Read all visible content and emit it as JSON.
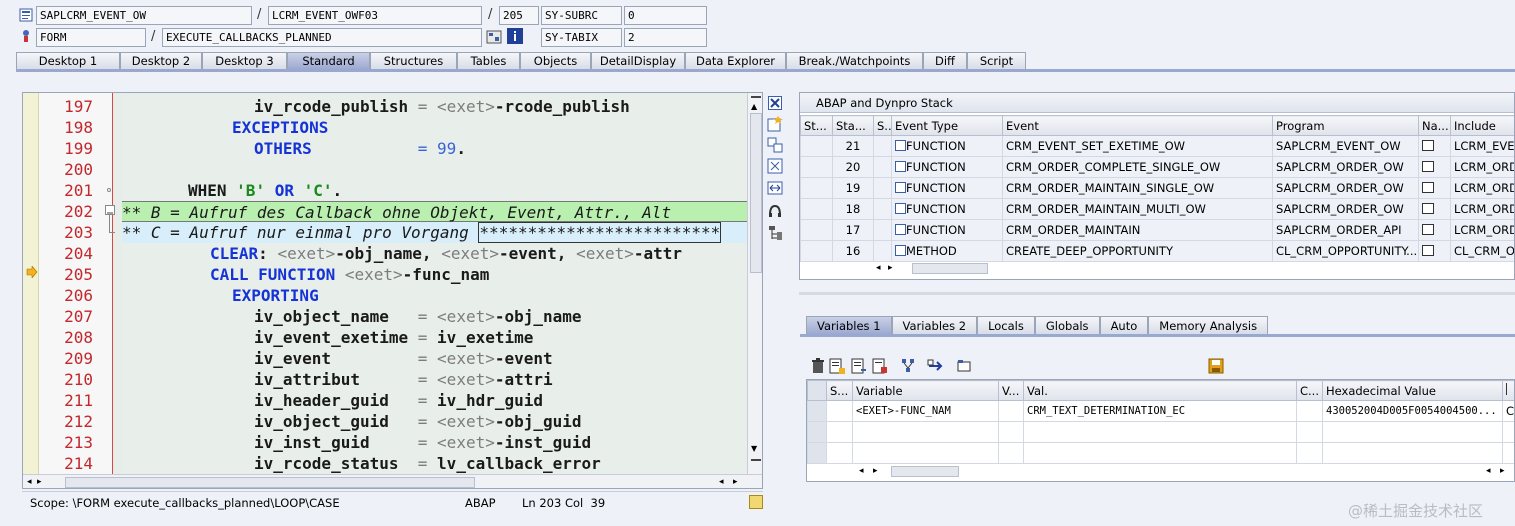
{
  "header": {
    "row1": {
      "program": "SAPLCRM_EVENT_OW",
      "include": "LCRM_EVENT_OWF03",
      "line": "205",
      "sysvar": "SY-SUBRC",
      "sysval": "0"
    },
    "row2": {
      "type": "FORM",
      "name": "EXECUTE_CALLBACKS_PLANNED",
      "sysvar": "SY-TABIX",
      "sysval": "2"
    }
  },
  "tabs": [
    "Desktop 1",
    "Desktop 2",
    "Desktop 3",
    "Standard",
    "Structures",
    "Tables",
    "Objects",
    "DetailDisplay",
    "Data Explorer",
    "Break./Watchpoints",
    "Diff",
    "Script"
  ],
  "active_tab": "Standard",
  "editor": {
    "line_numbers": [
      "197",
      "198",
      "199",
      "200",
      "201",
      "202",
      "203",
      "204",
      "205",
      "206",
      "207",
      "208",
      "209",
      "210",
      "211",
      "212",
      "213",
      "214"
    ],
    "current_line": "205",
    "code": {
      "l197a": "iv_rcode_publish",
      "l197op": "=",
      "l197b": "<exet>",
      "l197c": "-rcode_publish",
      "l198": "EXCEPTIONS",
      "l199a": "OTHERS",
      "l199op": "=",
      "l199n": "99",
      "l199d": ".",
      "l201a": "WHEN",
      "l201s1": "'B'",
      "l201or": "OR",
      "l201s2": "'C'",
      "l201d": ".",
      "l202": "** B = Aufruf des Callback ohne Objekt, Event, Attr., Alt",
      "l203a": "** C = Aufruf nur einmal pro Vorgang ",
      "l203b": "*************************",
      "l204a": "CLEAR",
      "l204b": ": ",
      "l204c": "<exet>",
      "l204d": "-obj_name, ",
      "l204e": "<exet>",
      "l204f": "-event, ",
      "l204g": "<exet>",
      "l204h": "-attr",
      "l205a": "CALL FUNCTION",
      "l205b": "<exet>",
      "l205c": "-func_nam",
      "l206": "EXPORTING",
      "l207a": "iv_object_name",
      "l207op": "=",
      "l207b": "<exet>",
      "l207c": "-obj_name",
      "l208a": "iv_event_exetime",
      "l208op": "=",
      "l208b": "iv_exetime",
      "l209a": "iv_event",
      "l209op": "=",
      "l209b": "<exet>",
      "l209c": "-event",
      "l210a": "iv_attribut",
      "l210op": "=",
      "l210b": "<exet>",
      "l210c": "-attri",
      "l211a": "iv_header_guid",
      "l211op": "=",
      "l211b": "iv_hdr_guid",
      "l212a": "iv_object_guid",
      "l212op": "=",
      "l212b": "<exet>",
      "l212c": "-obj_guid",
      "l213a": "iv_inst_guid",
      "l213op": "=",
      "l213b": "<exet>",
      "l213c": "-inst_guid",
      "l214a": "iv_rcode_status",
      "l214op": "=",
      "l214b": "lv_callback_error"
    }
  },
  "status": {
    "scope": "Scope: \\FORM execute_callbacks_planned\\LOOP\\CASE",
    "lang": "ABAP",
    "pos": "Ln 203 Col  39"
  },
  "stack": {
    "title": "ABAP and Dynpro Stack",
    "columns": [
      "St...",
      "Sta...",
      "S...",
      "Event Type",
      "Event",
      "Program",
      "Na...",
      "Include"
    ],
    "rows": [
      {
        "level": "21",
        "type": "FUNCTION",
        "event": "CRM_EVENT_SET_EXETIME_OW",
        "program": "SAPLCRM_EVENT_OW",
        "include": "LCRM_EVEN"
      },
      {
        "level": "20",
        "type": "FUNCTION",
        "event": "CRM_ORDER_COMPLETE_SINGLE_OW",
        "program": "SAPLCRM_ORDER_OW",
        "include": "LCRM_ORDE"
      },
      {
        "level": "19",
        "type": "FUNCTION",
        "event": "CRM_ORDER_MAINTAIN_SINGLE_OW",
        "program": "SAPLCRM_ORDER_OW",
        "include": "LCRM_ORDE"
      },
      {
        "level": "18",
        "type": "FUNCTION",
        "event": "CRM_ORDER_MAINTAIN_MULTI_OW",
        "program": "SAPLCRM_ORDER_OW",
        "include": "LCRM_ORDE"
      },
      {
        "level": "17",
        "type": "FUNCTION",
        "event": "CRM_ORDER_MAINTAIN",
        "program": "SAPLCRM_ORDER_API",
        "include": "LCRM_ORDE"
      },
      {
        "level": "16",
        "type": "METHOD",
        "event": "CREATE_DEEP_OPPORTUNITY",
        "program": "CL_CRM_OPPORTUNITY...",
        "include": "CL_CRM_OP"
      }
    ]
  },
  "var_tabs": [
    "Variables 1",
    "Variables 2",
    "Locals",
    "Globals",
    "Auto",
    "Memory Analysis"
  ],
  "variables": {
    "columns": [
      "S...",
      "Variable",
      "V...",
      "Val.",
      "C...",
      "Hexadecimal Value"
    ],
    "rows": [
      {
        "variable": "<EXET>-FUNC_NAM",
        "value": "CRM_TEXT_DETERMINATION_EC",
        "hex": "430052004D005F0054004500...",
        "extra": "C"
      }
    ]
  },
  "watermark": "@稀土掘金技术社区",
  "colors": {
    "accent": "#9aa7cf",
    "linenum": "#c2282d",
    "keyword": "#1533d6",
    "string": "#1a8a1a"
  }
}
